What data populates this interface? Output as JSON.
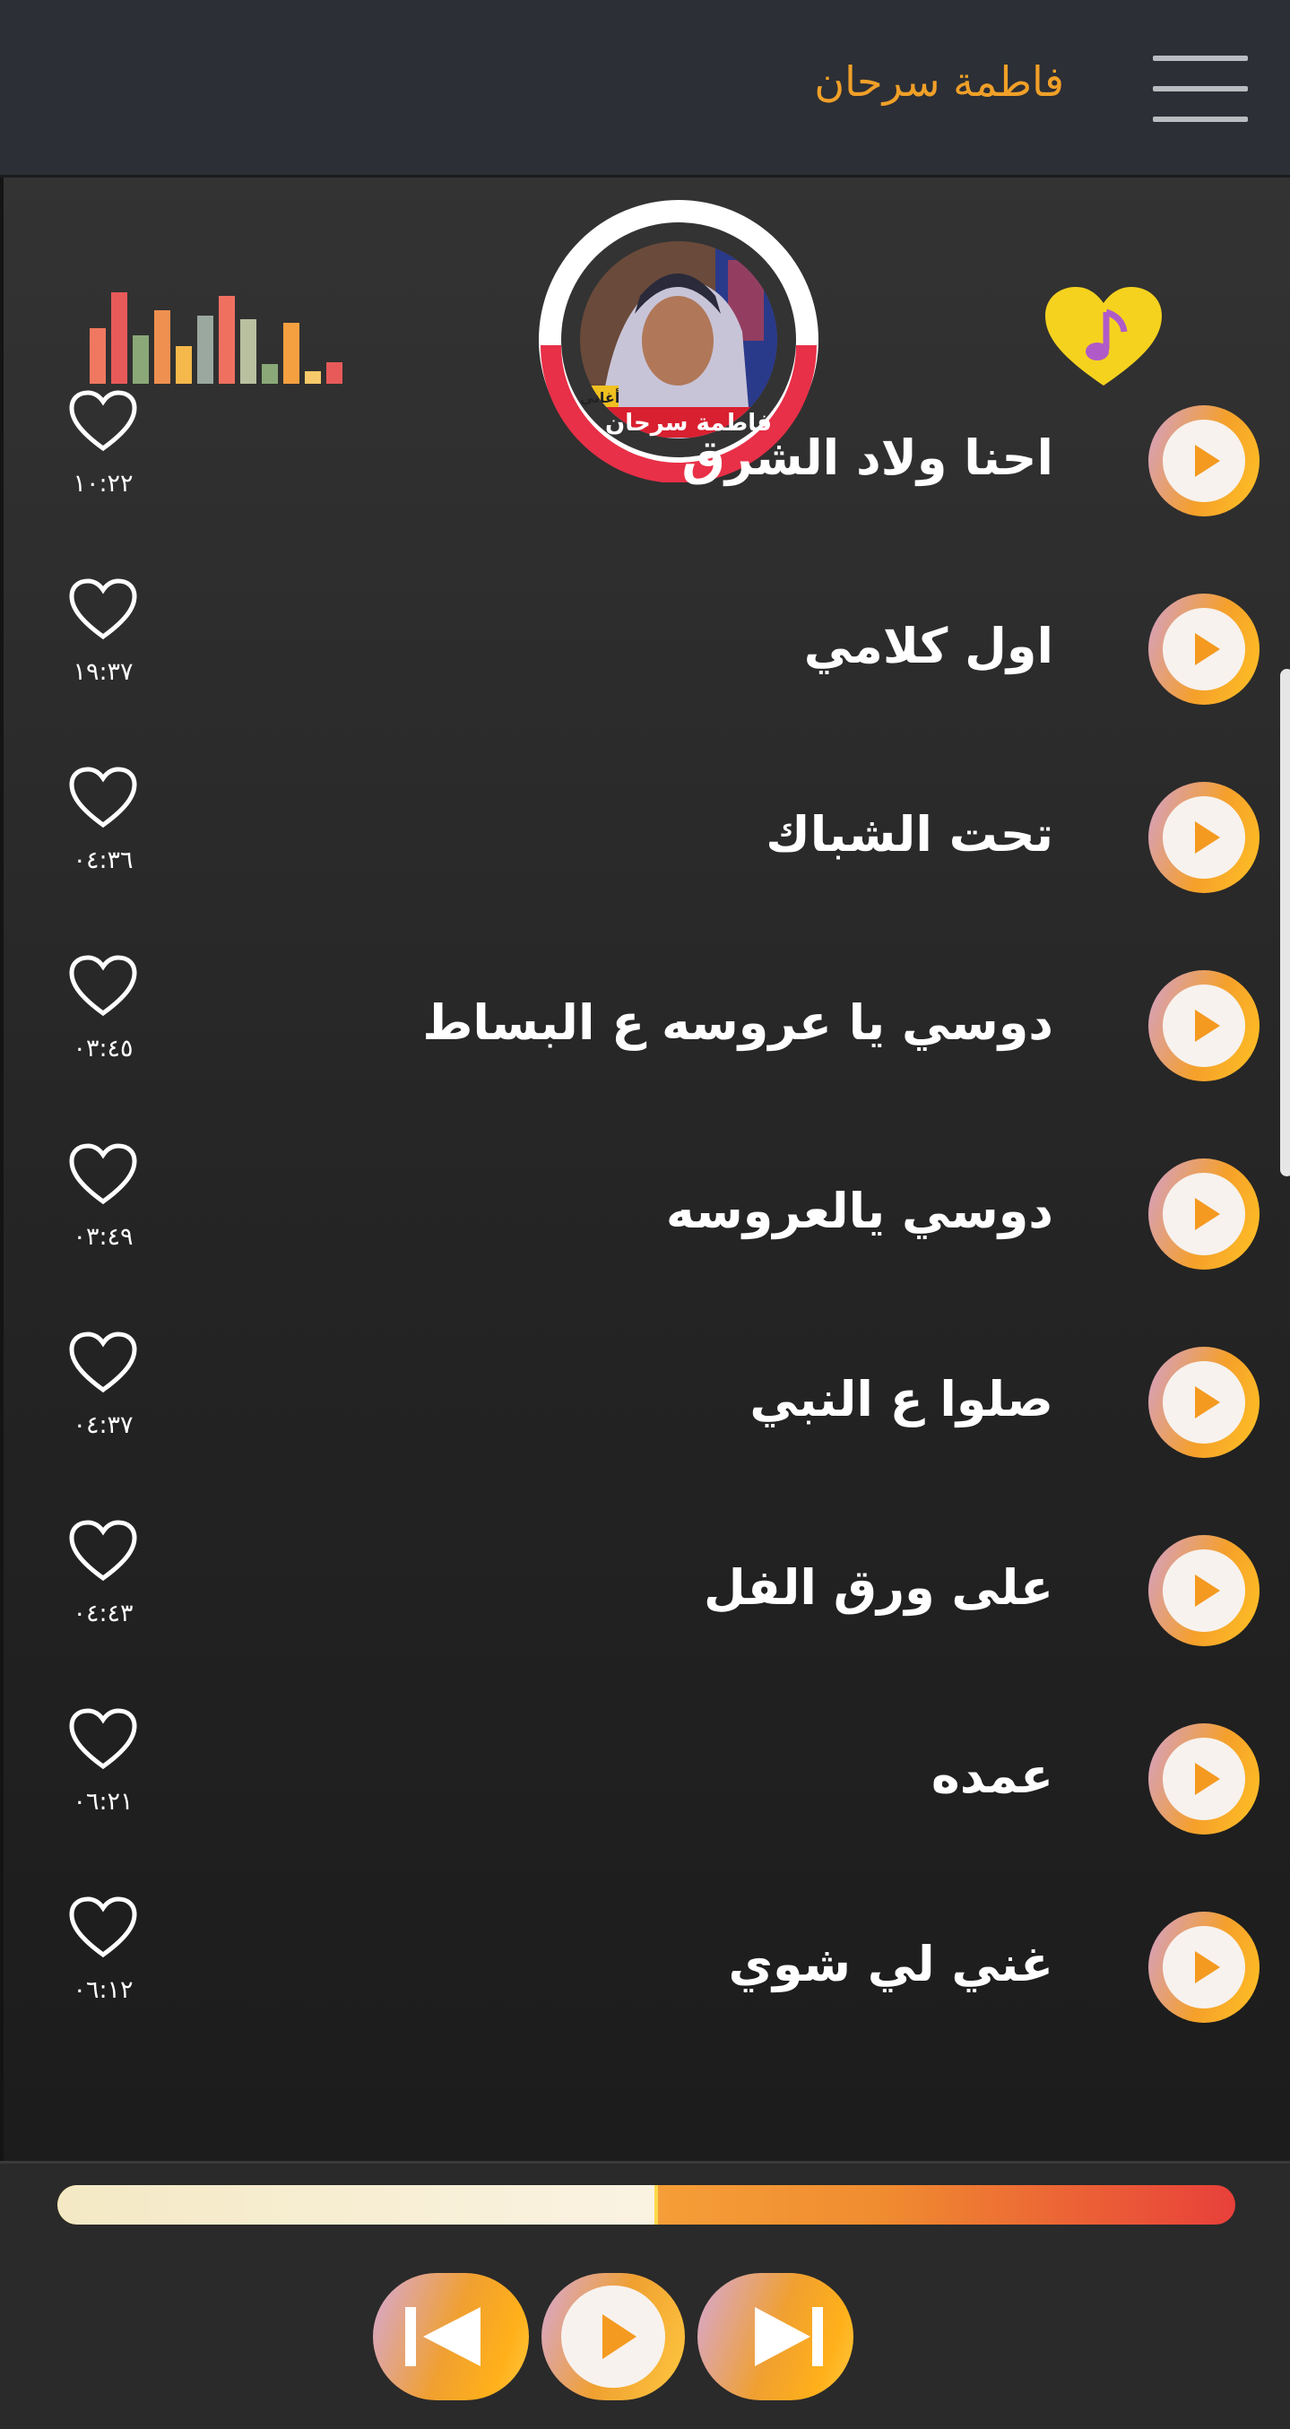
{
  "header": {
    "title": "فاطمة سرحان",
    "menu_icon": "hamburger-menu-icon"
  },
  "top": {
    "album_caption": "فاطمة سرحان",
    "album_badge": "أغاني",
    "equalizer_icon": "equalizer-icon",
    "favorites_icon": "heart-music-note-icon"
  },
  "tracks": [
    {
      "title": "احنا ولاد الشرق",
      "duration": "١٠:٢٢"
    },
    {
      "title": "اول كلامي",
      "duration": "١٩:٣٧"
    },
    {
      "title": "تحت الشباك",
      "duration": "٠٤:٣٦"
    },
    {
      "title": "دوسي يا عروسه ع البساط",
      "duration": "٠٣:٤٥"
    },
    {
      "title": "دوسي يالعروسه",
      "duration": "٠٣:٤٩"
    },
    {
      "title": "صلوا ع النبي",
      "duration": "٠٤:٣٧"
    },
    {
      "title": "على ورق الفل",
      "duration": "٠٤:٤٣"
    },
    {
      "title": "عمده",
      "duration": "٠٦:٢١"
    },
    {
      "title": "غني لي شوي",
      "duration": "٠٦:١٢"
    }
  ],
  "player": {
    "progress_fraction": 0.51,
    "prev_icon": "skip-previous-icon",
    "play_icon": "play-icon",
    "next_icon": "skip-next-icon"
  },
  "colors": {
    "accent": "#f0a028",
    "header_bg": "#2c2f35",
    "background": "#222222"
  }
}
